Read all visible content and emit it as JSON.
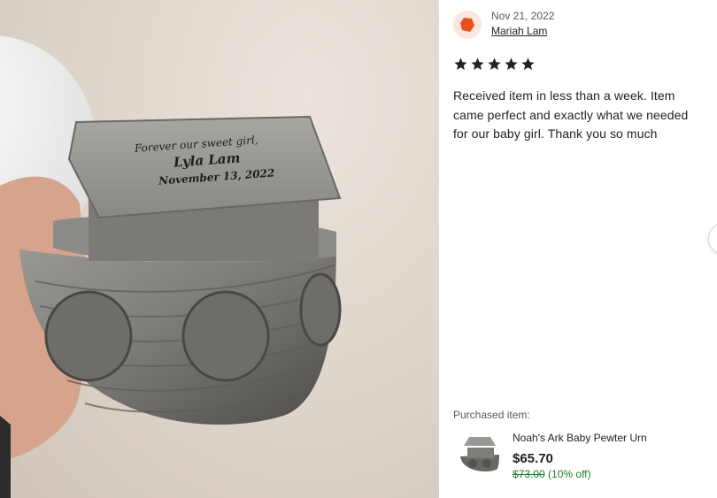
{
  "photo": {
    "engraving": {
      "line1": "Forever our sweet girl,",
      "line2": "Lyla Lam",
      "line3": "November 13, 2022"
    }
  },
  "review": {
    "date": "Nov 21, 2022",
    "reviewer": "Mariah Lam",
    "rating": 5,
    "text": "Received item in less than a week. Item came perfect and exactly what we needed for our baby girl. Thank you so much"
  },
  "purchased": {
    "label": "Purchased item:",
    "name": "Noah's Ark Baby Pewter Urn",
    "price": "$65.70",
    "original_price": "$73.00",
    "discount": "(10% off)"
  },
  "colors": {
    "avatar_bg": "#fbe7df",
    "avatar_shape": "#e8501e",
    "star": "#222222",
    "discount": "#1c7d34"
  },
  "icons": {
    "avatar": "orange-hexagon-icon",
    "star": "star-icon",
    "next": "chevron-right-icon"
  }
}
